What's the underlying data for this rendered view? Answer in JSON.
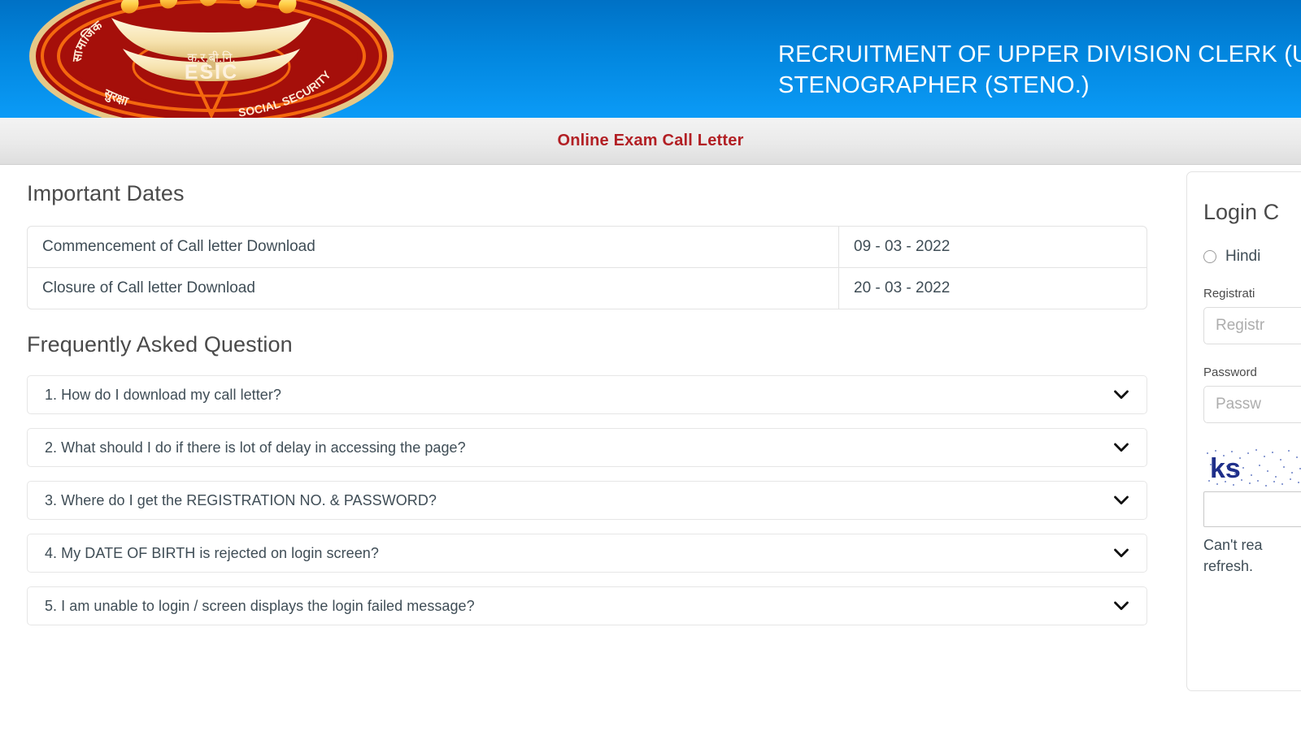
{
  "header": {
    "title_line1": "RECRUITMENT OF UPPER DIVISION CLERK (UDC) AND",
    "title_line2": "STENOGRAPHER (STENO.)",
    "logo_alt": "esic-logo",
    "logo_text_en": "ESIC",
    "logo_text_abbr": "क.र.बी.नि.",
    "logo_text_hi_left": "सामाजिक",
    "logo_text_hi_right": "सुरक्षा",
    "logo_text_en_arc": "SOCIAL SECURITY",
    "brand_blue": "#0286de"
  },
  "subtitle": {
    "text": "Online Exam Call Letter",
    "color": "#b21f24"
  },
  "important_dates": {
    "heading": "Important Dates",
    "rows": [
      {
        "label": "Commencement of Call letter Download",
        "value": "09 - 03 - 2022"
      },
      {
        "label": "Closure of Call letter Download",
        "value": "20 - 03 - 2022"
      }
    ]
  },
  "faq": {
    "heading": "Frequently Asked Question",
    "items": [
      {
        "question": "1. How do I download my call letter?",
        "icon": "chevron-down-icon"
      },
      {
        "question": "2. What should I do if there is lot of delay in accessing the page?",
        "icon": "chevron-down-icon"
      },
      {
        "question": "3. Where do I get the REGISTRATION NO. & PASSWORD?",
        "icon": "chevron-down-icon"
      },
      {
        "question": "4. My DATE OF BIRTH is rejected on login screen?",
        "icon": "chevron-down-icon"
      },
      {
        "question": "5. I am unable to login / screen displays the login failed message?",
        "icon": "chevron-down-icon"
      }
    ]
  },
  "login": {
    "heading": "Login C",
    "language_options": [
      {
        "label": "Hindi",
        "selected": false
      }
    ],
    "registration": {
      "label": "Registrati",
      "placeholder": "Registr",
      "value": ""
    },
    "password": {
      "label": "Password",
      "placeholder": "Passw",
      "value": ""
    },
    "captcha": {
      "text": "ks",
      "input_value": "",
      "hint_line1": "Can't rea",
      "hint_line2": "refresh."
    }
  }
}
